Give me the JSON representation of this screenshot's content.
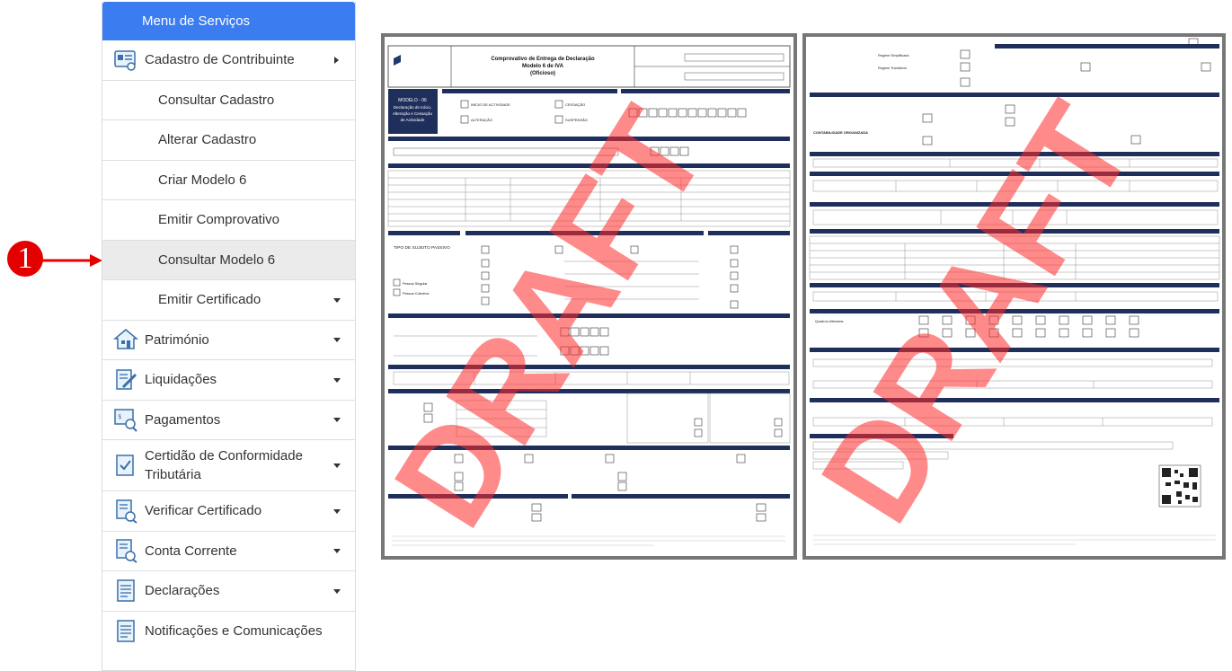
{
  "sidebar": {
    "header": "Menu de Serviços",
    "items": [
      {
        "label": "Cadastro de Contribuinte"
      },
      {
        "label": "Consultar Cadastro"
      },
      {
        "label": "Alterar Cadastro"
      },
      {
        "label": "Criar Modelo 6"
      },
      {
        "label": "Emitir Comprovativo"
      },
      {
        "label": "Consultar Modelo 6"
      },
      {
        "label": "Emitir Certificado"
      },
      {
        "label": "Património"
      },
      {
        "label": "Liquidações"
      },
      {
        "label": "Pagamentos"
      },
      {
        "label": "Certidão de Conformidade Tributária"
      },
      {
        "label": "Verificar Certificado"
      },
      {
        "label": "Conta Corrente"
      },
      {
        "label": "Declarações"
      },
      {
        "label": "Notificações e Comunicações"
      }
    ]
  },
  "callout": {
    "number": "1"
  },
  "doc1": {
    "title_line1": "Comprovativo de Entrega de Declaração",
    "title_line2": "Modelo 6 de IVA",
    "title_line3": "(Oficioso)",
    "section_title_1": "MODELO - 06",
    "section_title_2": "Declaração de Início,",
    "section_title_3": "Alteração e Cessação",
    "section_title_4": "de Actividade",
    "label_inicio": "INÍCIO DE ACTIVIDADE",
    "label_alteracao": "ALTERAÇÃO",
    "label_cessacao": "CESSAÇÃO",
    "label_suspensao": "SUSPENSÃO",
    "label_tipo_sujeito": "TIPO DE SUJEITO PASSIVO",
    "label_pessoa_singular": "Pessoa Singular",
    "label_pessoa_colectiva": "Pessoa Colectiva",
    "watermark": "DRAFT"
  },
  "doc2": {
    "label_contabilidade": "CONTABILIDADE ORGANIZADA",
    "label_regime_simplificado": "Regime Simplificado",
    "label_regime_transitorio": "Regime Transitório",
    "label_quadro_alteracoes": "Quadros Alterados",
    "watermark": "DRAFT"
  }
}
